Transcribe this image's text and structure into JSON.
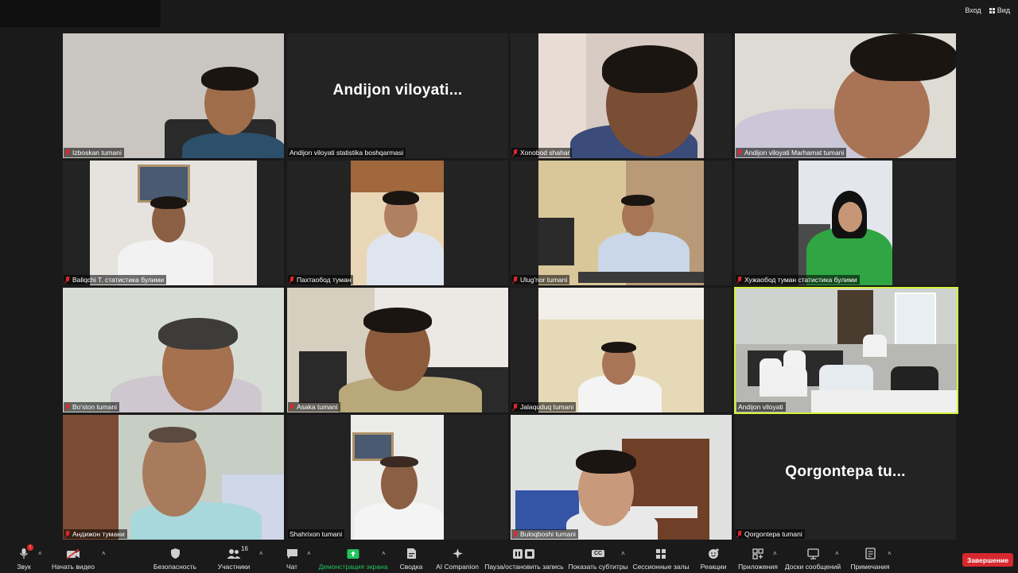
{
  "header": {
    "enter_label": "Вход",
    "view_label": "Вид"
  },
  "tiles": [
    {
      "name": "Izboskan tumani"
    },
    {
      "name": "Andijon viloyati statistika boshqarmasi",
      "big": "Andijon viloyati..."
    },
    {
      "name": "Xonobod shahar"
    },
    {
      "name": "Andijon viloyati Marhamat tumani"
    },
    {
      "name": "Baliqchi T. статистика булими"
    },
    {
      "name": "Пахтаобод туман"
    },
    {
      "name": "Ulug'nor tumani"
    },
    {
      "name": "Хужаобод туман статистика булими"
    },
    {
      "name": "Bo'ston tumani"
    },
    {
      "name": "Asaka tumani"
    },
    {
      "name": "Jalaquduq tumani"
    },
    {
      "name": "Andijon viloyati"
    },
    {
      "name": "Андижон тумани"
    },
    {
      "name": "Shahrixon tumani"
    },
    {
      "name": "Buloqboshi tumani"
    },
    {
      "name": "Qorgontepa tumani",
      "big": "Qorgontepa tu..."
    }
  ],
  "toolbar": {
    "audio": "Звук",
    "audio_badge": "!",
    "video": "Начать видео",
    "security": "Безопасность",
    "participants": "Участники",
    "participants_count": "16",
    "chat": "Чат",
    "share": "Демонстрация экрана",
    "whiteboard": "Сводка",
    "ai": "AI Companion",
    "record": "Пауза/остановить запись",
    "captions": "Показать субтитры",
    "captions_icon": "CC",
    "breakout": "Сессионные залы",
    "reactions": "Реакции",
    "apps": "Приложения",
    "whiteboards": "Доски сообщений",
    "notes": "Примечания",
    "end": "Завершение"
  },
  "colors": {
    "background": "#1a1a1a",
    "active_speaker": "#d4f23b",
    "end_button": "#d7282f",
    "share_green": "#25c25e",
    "mute_red": "#e02828"
  }
}
